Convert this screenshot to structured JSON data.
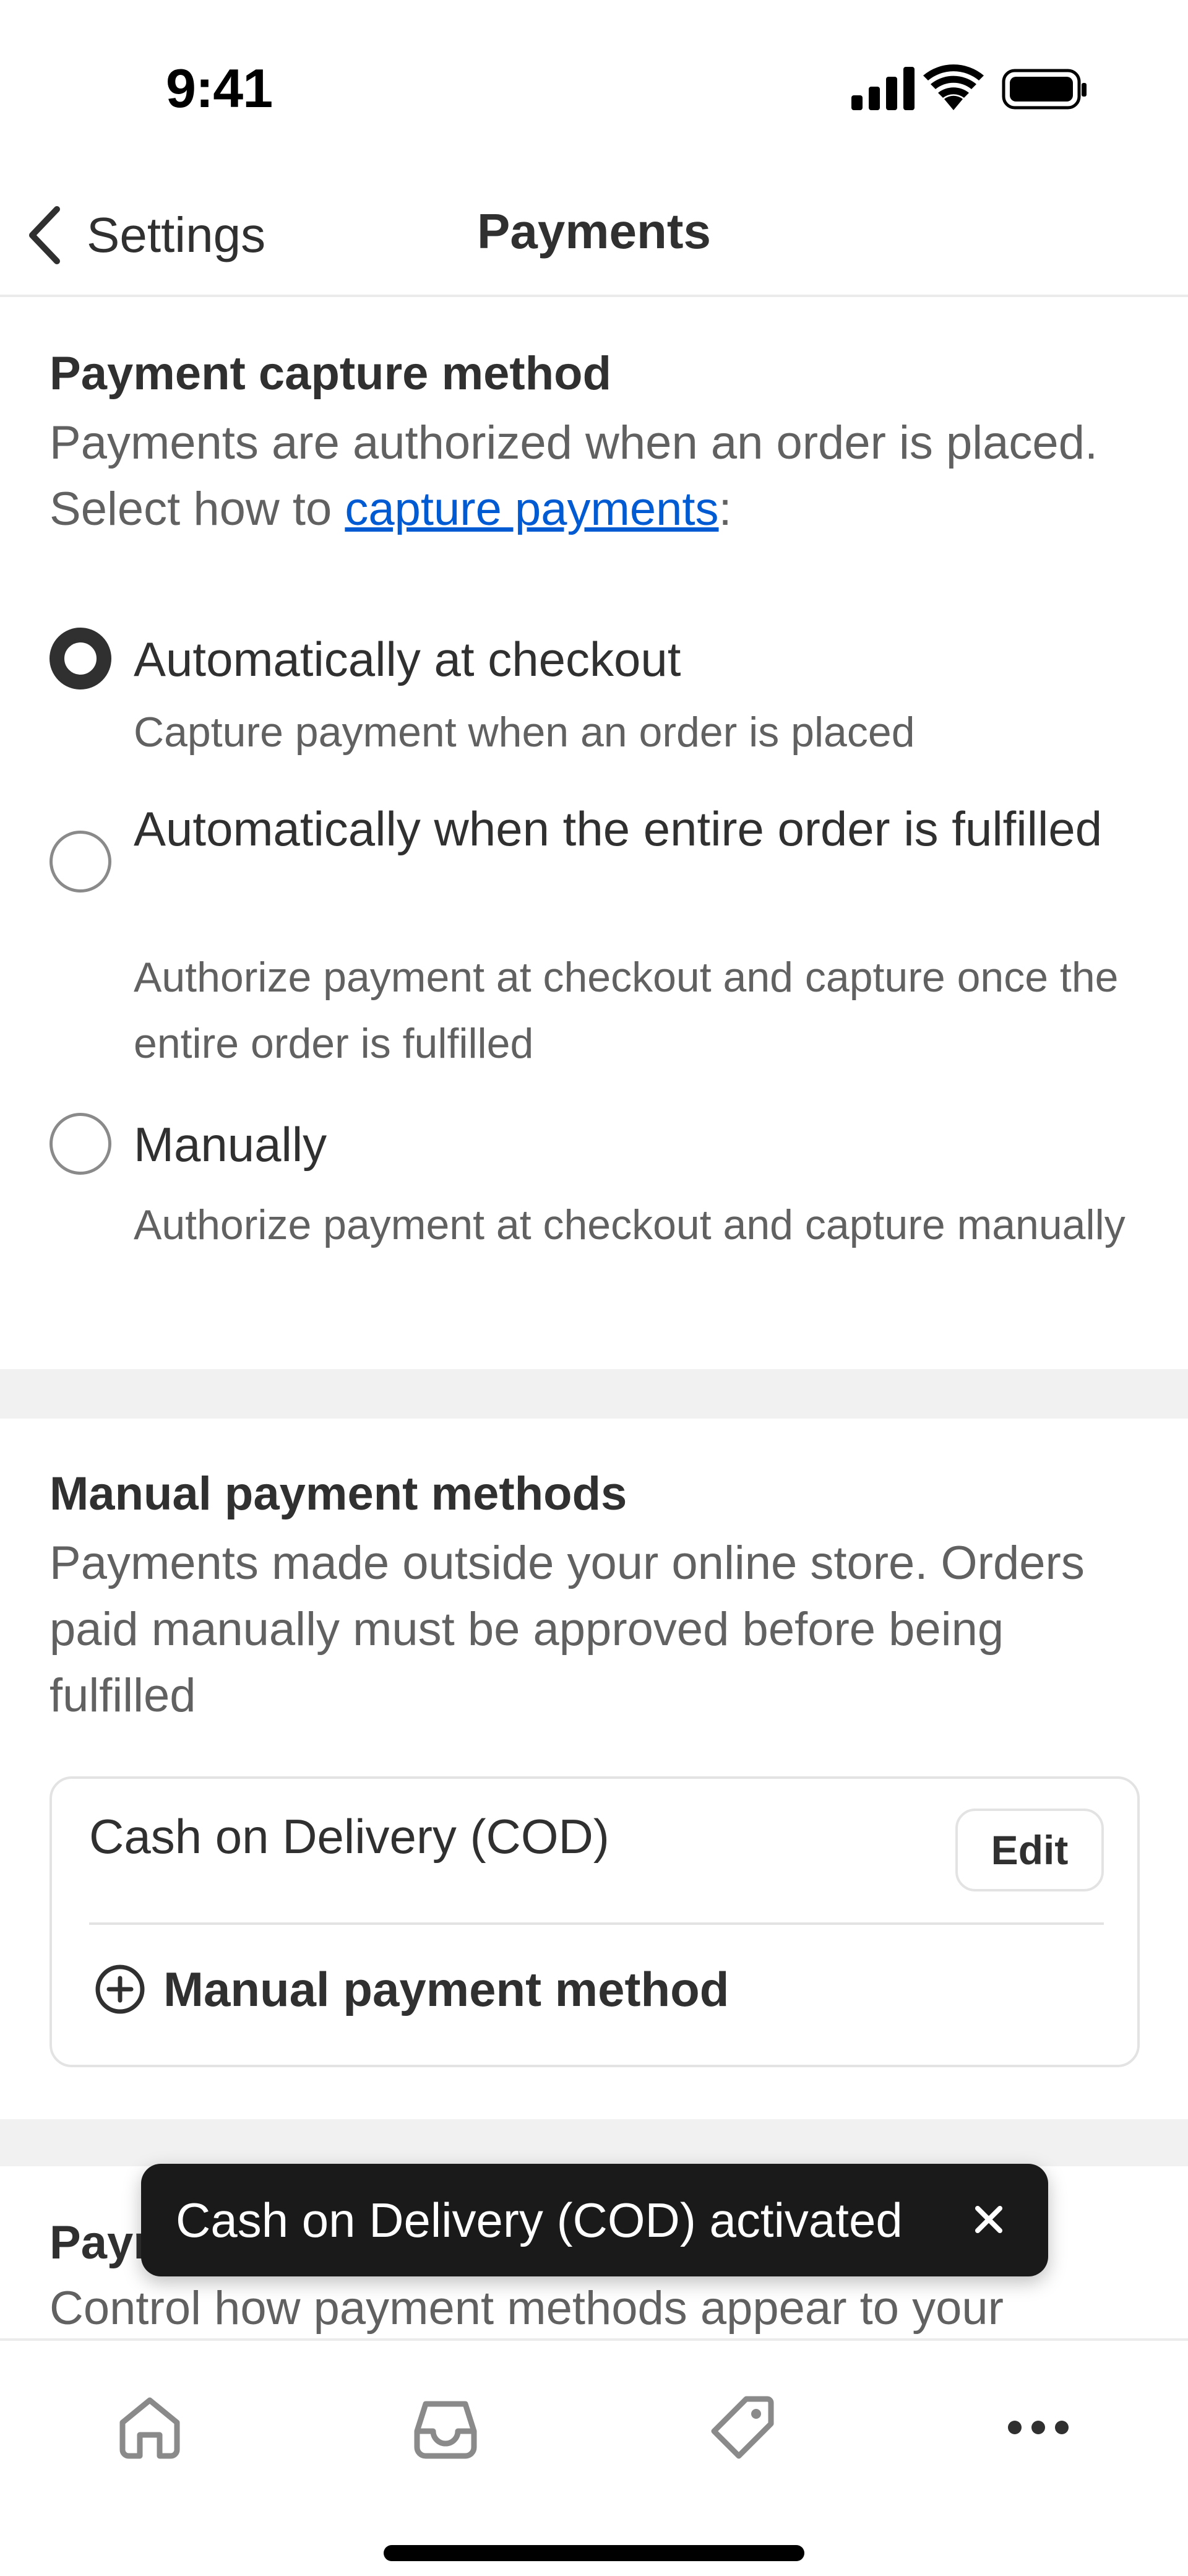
{
  "status_bar": {
    "time": "9:41",
    "icons": [
      "cellular-signal-icon",
      "wifi-icon",
      "battery-icon"
    ]
  },
  "nav": {
    "back_label": "Settings",
    "title": "Payments",
    "back_icon": "chevron-left-icon"
  },
  "capture": {
    "title": "Payment capture method",
    "desc_before_link": "Payments are authorized when an order is placed. Select how to ",
    "desc_link": "capture payments",
    "desc_after_link": ":",
    "selected_option": "Automatically at checkout",
    "options": [
      {
        "label": "Automatically at checkout",
        "help": "Capture payment when an order is placed",
        "checked": true
      },
      {
        "label": "Automatically when the entire order is fulfilled",
        "help": "Authorize payment at checkout and capture once the entire order is fulfilled",
        "checked": false
      },
      {
        "label": "Manually",
        "help": "Authorize payment at checkout and capture manually",
        "checked": false
      }
    ]
  },
  "manual_methods": {
    "title": "Manual payment methods",
    "desc": "Payments made outside your online store. Orders paid manually must be approved before being fulfilled",
    "methods": [
      {
        "name": "Cash on Delivery (COD)",
        "action_label": "Edit"
      }
    ],
    "add_label": "Manual payment method",
    "add_icon": "plus-circle-icon"
  },
  "customizations": {
    "title": "Payment customizations",
    "desc": "Control how payment methods appear to your"
  },
  "toast": {
    "message": "Cash on Delivery (COD) activated",
    "close_icon": "close-icon"
  },
  "tab_bar": {
    "tabs": [
      {
        "name": "home",
        "icon": "home-icon"
      },
      {
        "name": "orders",
        "icon": "inbox-icon"
      },
      {
        "name": "products",
        "icon": "tag-icon"
      },
      {
        "name": "more",
        "icon": "more-icon"
      }
    ]
  },
  "colors": {
    "text_primary": "#303030",
    "text_secondary": "#616161",
    "link": "#005bd3",
    "toast_bg": "#1a1a1a",
    "section_band": "#f1f1f1"
  }
}
